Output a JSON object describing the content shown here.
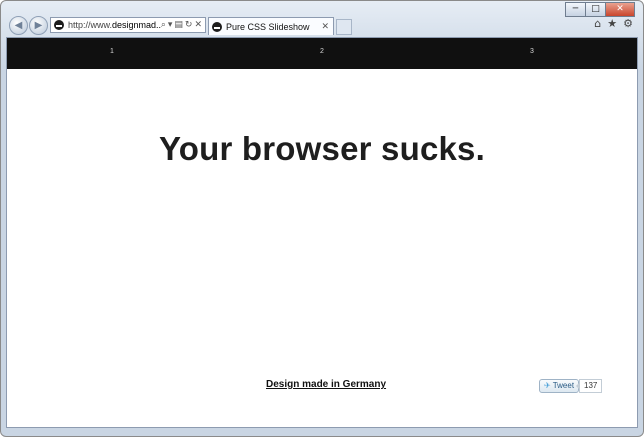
{
  "window": {
    "minimize_glyph": "─",
    "maximize_glyph": "□",
    "close_glyph": "✕"
  },
  "toolbar": {
    "back_glyph": "◀",
    "forward_glyph": "▶",
    "address_prefix": "http://www.",
    "address_host": "designmad...",
    "search_glyph": "⌕",
    "dropdown_glyph": "▾",
    "compat_glyph": "▤",
    "refresh_glyph": "↻",
    "stop_glyph": "✕",
    "home_glyph": "⌂",
    "favorites_glyph": "★",
    "tools_glyph": "⚙"
  },
  "tab": {
    "title": "Pure CSS Slideshow",
    "close_glyph": "✕"
  },
  "slide_nav": [
    "1",
    "2",
    "3"
  ],
  "headline": "Your browser sucks.",
  "footer": {
    "link_text": "Design made in Germany"
  },
  "tweet": {
    "label": "Tweet",
    "bird_glyph": "✈",
    "count": "137"
  },
  "colors": {
    "nav_bar": "#101010",
    "headline": "#1e1e1e",
    "page_bg": "#ffffff",
    "chrome": "#c9d5e3"
  }
}
